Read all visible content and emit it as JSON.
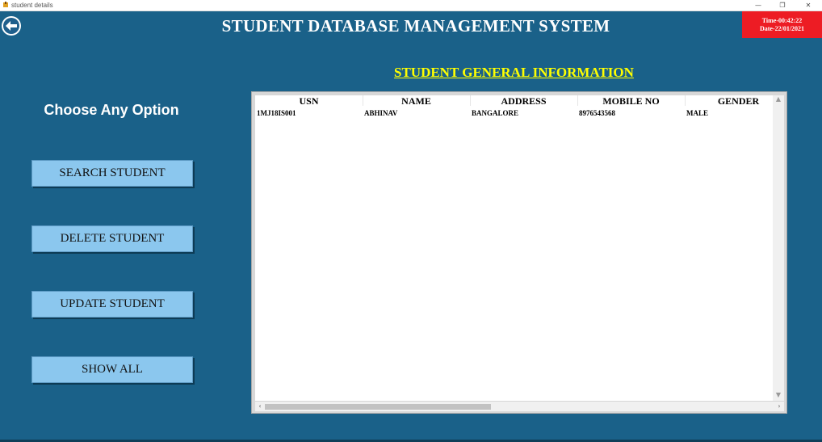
{
  "window": {
    "title": "student details",
    "minimize": "—",
    "restore": "❐",
    "close": "✕"
  },
  "header": {
    "title": "STUDENT DATABASE MANAGEMENT SYSTEM",
    "time": "Time-00:42:22",
    "date": "Date-22/01/2021"
  },
  "section_title": "STUDENT GENERAL INFORMATION",
  "sidebar": {
    "heading": "Choose Any Option",
    "buttons": [
      "SEARCH STUDENT",
      "DELETE STUDENT",
      "UPDATE STUDENT",
      "SHOW ALL"
    ]
  },
  "table": {
    "columns": [
      "USN",
      "NAME",
      "ADDRESS",
      "MOBILE NO",
      "GENDER"
    ],
    "rows": [
      [
        "1MJ18IS001",
        "ABHINAV",
        "BANGALORE",
        "8976543568",
        "MALE"
      ]
    ]
  },
  "icons": {
    "back": "back-arrow-icon",
    "app": "app-icon"
  },
  "colors": {
    "background": "#1a6189",
    "clock_bg": "#ed1c24",
    "subheading": "#ffff00",
    "button_bg": "#8bc7ee"
  }
}
